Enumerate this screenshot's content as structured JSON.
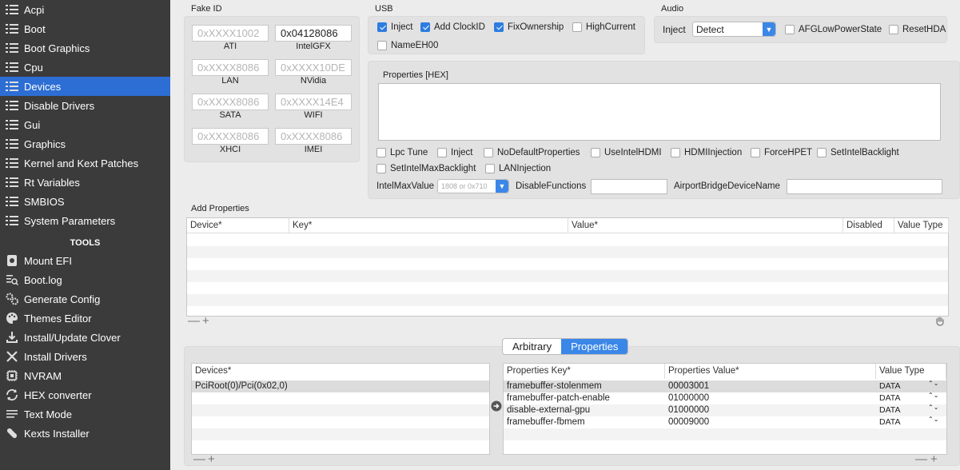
{
  "sidebar": {
    "items": [
      {
        "label": "Acpi",
        "active": false
      },
      {
        "label": "Boot",
        "active": false
      },
      {
        "label": "Boot Graphics",
        "active": false
      },
      {
        "label": "Cpu",
        "active": false
      },
      {
        "label": "Devices",
        "active": true
      },
      {
        "label": "Disable Drivers",
        "active": false
      },
      {
        "label": "Gui",
        "active": false
      },
      {
        "label": "Graphics",
        "active": false
      },
      {
        "label": "Kernel and Kext Patches",
        "active": false
      },
      {
        "label": "Rt Variables",
        "active": false
      },
      {
        "label": "SMBIOS",
        "active": false
      },
      {
        "label": "System Parameters",
        "active": false
      }
    ],
    "tools_title": "TOOLS",
    "tools": [
      {
        "label": "Mount EFI",
        "icon": "disk-icon"
      },
      {
        "label": "Boot.log",
        "icon": "log-search-icon"
      },
      {
        "label": "Generate Config",
        "icon": "gears-icon"
      },
      {
        "label": "Themes Editor",
        "icon": "palette-icon"
      },
      {
        "label": "Install/Update Clover",
        "icon": "download-icon"
      },
      {
        "label": "Install Drivers",
        "icon": "wrench-icon"
      },
      {
        "label": "NVRAM",
        "icon": "chip-icon"
      },
      {
        "label": "HEX converter",
        "icon": "refresh-icon"
      },
      {
        "label": "Text Mode",
        "icon": "text-lines-icon"
      },
      {
        "label": "Kexts Installer",
        "icon": "puzzle-icon"
      }
    ]
  },
  "fake_id": {
    "title": "Fake ID",
    "fields": [
      {
        "label": "ATI",
        "value": "0xXXXX1002",
        "filled": false
      },
      {
        "label": "IntelGFX",
        "value": "0x04128086",
        "filled": true
      },
      {
        "label": "LAN",
        "value": "0xXXXX8086",
        "filled": false
      },
      {
        "label": "NVidia",
        "value": "0xXXXX10DE",
        "filled": false
      },
      {
        "label": "SATA",
        "value": "0xXXXX8086",
        "filled": false
      },
      {
        "label": "WIFI",
        "value": "0xXXXX14E4",
        "filled": false
      },
      {
        "label": "XHCI",
        "value": "0xXXXX8086",
        "filled": false
      },
      {
        "label": "IMEI",
        "value": "0xXXXX8086",
        "filled": false
      }
    ]
  },
  "usb": {
    "title": "USB",
    "options": [
      {
        "label": "Inject",
        "checked": true
      },
      {
        "label": "Add ClockID",
        "checked": true
      },
      {
        "label": "FixOwnership",
        "checked": true
      },
      {
        "label": "HighCurrent",
        "checked": false
      },
      {
        "label": "NameEH00",
        "checked": false
      }
    ]
  },
  "audio": {
    "title": "Audio",
    "inject_label": "Inject",
    "inject_value": "Detect",
    "options": [
      {
        "label": "AFGLowPowerState",
        "checked": false
      },
      {
        "label": "ResetHDA",
        "checked": false
      }
    ]
  },
  "properties": {
    "title": "Properties [HEX]",
    "options": [
      {
        "label": "Lpc Tune",
        "checked": false
      },
      {
        "label": "Inject",
        "checked": false
      },
      {
        "label": "NoDefaultProperties",
        "checked": false
      },
      {
        "label": "UseIntelHDMI",
        "checked": false
      },
      {
        "label": "HDMIInjection",
        "checked": false
      },
      {
        "label": "ForceHPET",
        "checked": false
      },
      {
        "label": "SetIntelBacklight",
        "checked": false
      },
      {
        "label": "SetIntelMaxBacklight",
        "checked": false
      },
      {
        "label": "LANInjection",
        "checked": false
      }
    ],
    "intel_max_label": "IntelMaxValue",
    "intel_max_placeholder": "1808 or 0x710",
    "disable_functions_label": "DisableFunctions",
    "airport_label": "AirportBridgeDeviceName"
  },
  "add_properties": {
    "title": "Add Properties",
    "columns": [
      "Device*",
      "Key*",
      "Value*",
      "Disabled",
      "Value Type"
    ]
  },
  "tabs": {
    "items": [
      {
        "label": "Arbitrary",
        "selected": false
      },
      {
        "label": "Properties",
        "selected": true
      }
    ]
  },
  "devices_table": {
    "column": "Devices*",
    "rows": [
      "PciRoot(0)/Pci(0x02,0)"
    ]
  },
  "props_table": {
    "columns": [
      "Properties Key*",
      "Properties Value*",
      "Value Type"
    ],
    "rows": [
      {
        "key": "framebuffer-stolenmem",
        "value": "00003001",
        "type": "DATA"
      },
      {
        "key": "framebuffer-patch-enable",
        "value": "01000000",
        "type": "DATA"
      },
      {
        "key": "disable-external-gpu",
        "value": "01000000",
        "type": "DATA"
      },
      {
        "key": "framebuffer-fbmem",
        "value": "00009000",
        "type": "DATA"
      }
    ]
  },
  "symbols": {
    "minus": "—",
    "plus": "+",
    "updown": "⌃⌄"
  }
}
